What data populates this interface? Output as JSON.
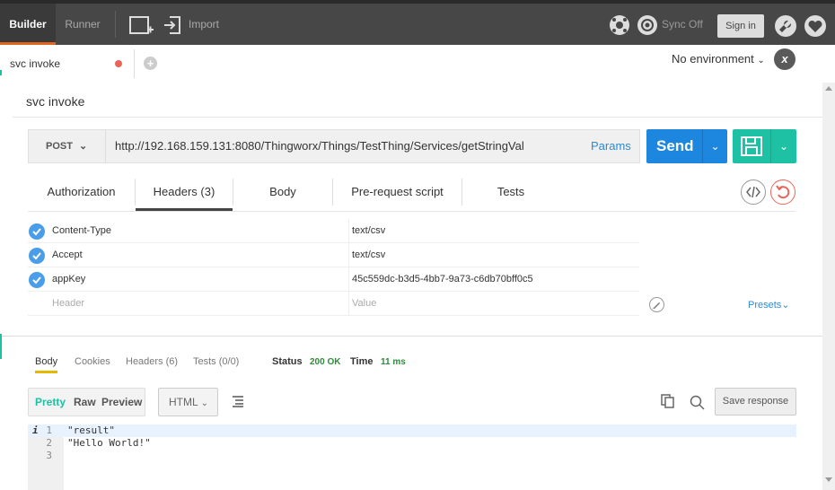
{
  "topbar": {
    "builder_label": "Builder",
    "runner_label": "Runner",
    "import_label": "Import",
    "sync_label": "Sync Off",
    "signin_label": "Sign in"
  },
  "tabs": {
    "active_tab_label": "svc invoke"
  },
  "environment": {
    "selected": "No environment"
  },
  "request": {
    "title": "svc invoke",
    "method": "POST",
    "url": "http://192.168.159.131:8080/Thingworx/Things/TestThing/Services/getStringVal",
    "params_label": "Params",
    "send_label": "Send"
  },
  "request_tabs": [
    {
      "label": "Authorization"
    },
    {
      "label": "Headers (3)"
    },
    {
      "label": "Body"
    },
    {
      "label": "Pre-request script"
    },
    {
      "label": "Tests"
    }
  ],
  "headers": [
    {
      "key": "Content-Type",
      "value": "text/csv"
    },
    {
      "key": "Accept",
      "value": "text/csv"
    },
    {
      "key": "appKey",
      "value": "45c559dc-b3d5-4bb7-9a73-c6db70bff0c5"
    }
  ],
  "header_placeholder": {
    "key": "Header",
    "value": "Value"
  },
  "presets_label": "Presets",
  "response": {
    "tabs": [
      {
        "label": "Body"
      },
      {
        "label": "Cookies"
      },
      {
        "label": "Headers (6)"
      },
      {
        "label": "Tests (0/0)"
      }
    ],
    "status_label": "Status",
    "status_value": "200 OK",
    "time_label": "Time",
    "time_value": "11 ms",
    "format_options": [
      "Pretty",
      "Raw",
      "Preview"
    ],
    "language": "HTML",
    "save_response_label": "Save response",
    "lines": [
      {
        "num": "1",
        "text": "\"result\""
      },
      {
        "num": "2",
        "text": "\"Hello World!\""
      },
      {
        "num": "3",
        "text": ""
      }
    ]
  },
  "colors": {
    "send": "#1d87e0",
    "save": "#1ec1a4",
    "status_ok": "#2e8b3b",
    "unsaved_dot": "#e8655a"
  }
}
